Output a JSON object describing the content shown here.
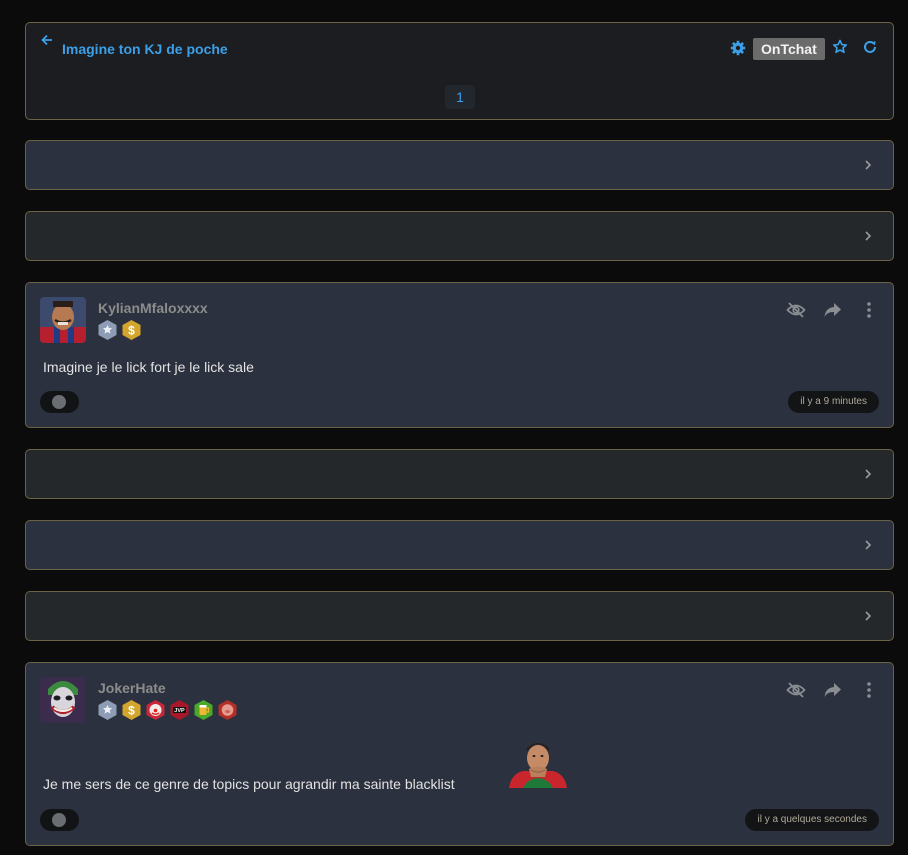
{
  "header": {
    "title": "Imagine ton KJ de poche",
    "ontchat_label": "OnTchat",
    "page": "1"
  },
  "posts": [
    {
      "username": "KylianMfaloxxxx",
      "text": "Imagine je le lick fort je le lick sale",
      "timestamp": "il y a 9 minutes",
      "badges": [
        "star-badge-icon",
        "dollar-badge-icon"
      ]
    },
    {
      "username": "JokerHate",
      "text": "Je me sers de ce genre de topics pour agrandir ma sainte blacklist",
      "timestamp": "il y a quelques secondes",
      "badges": [
        "star-badge-icon",
        "dollar-badge-icon",
        "clown-badge-icon",
        "jvp-badge-icon",
        "beer-badge-icon",
        "pig-badge-icon"
      ]
    }
  ],
  "colors": {
    "accent": "#3d9fe8",
    "card_border": "#6b6346",
    "card_dark": "#25282a",
    "card_blue": "#2b313e"
  }
}
